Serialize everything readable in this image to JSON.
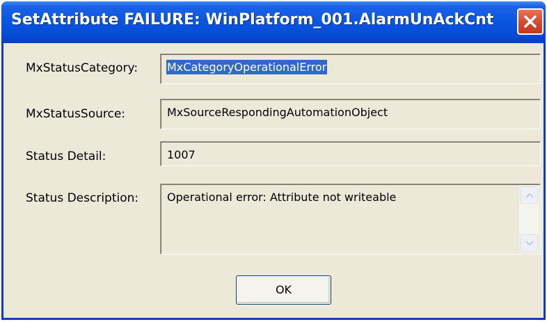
{
  "window": {
    "title": "SetAttribute FAILURE: WinPlatform_001.AlarmUnAckCnt",
    "close_icon": "close-icon"
  },
  "fields": {
    "category_label": "MxStatusCategory:",
    "category_value": "MxCategoryOperationalError",
    "source_label": "MxStatusSource:",
    "source_value": "MxSourceRespondingAutomationObject",
    "detail_label": "Status Detail:",
    "detail_value": "1007",
    "description_label": "Status Description:",
    "description_value": "Operational error: Attribute not writeable"
  },
  "buttons": {
    "ok_label": "OK"
  },
  "colors": {
    "titlebar": "#0a55e0",
    "close": "#d9492e",
    "dialog_bg": "#ece9d8",
    "selection": "#316ac5"
  }
}
